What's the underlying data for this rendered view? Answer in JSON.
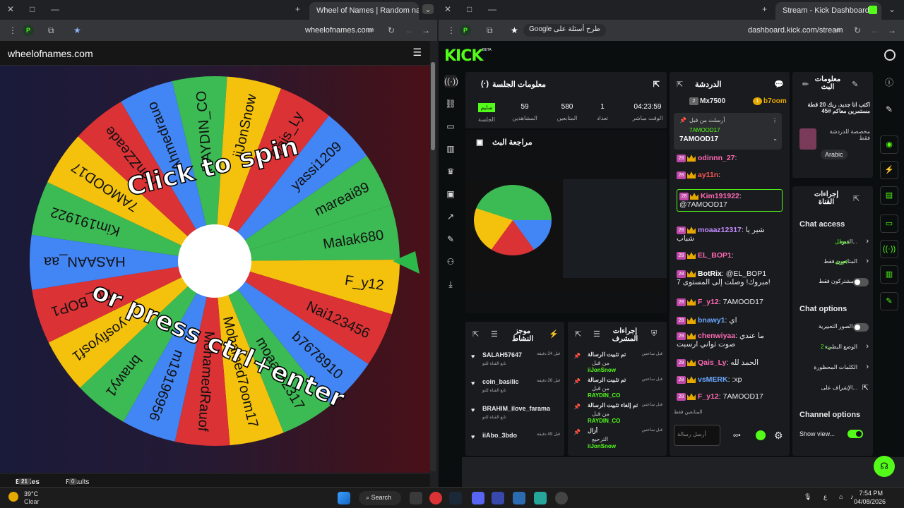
{
  "left_browser": {
    "tab_title": "Wheel of Names | Random nam",
    "url": "wheelofnames.com",
    "site_title": "wheelofnames.com",
    "wheel": {
      "names": [
        "Malak680",
        "F_y12",
        "Nai123456",
        "b7678910",
        "moaaz12317",
        "Mohamed7oom17",
        "MohamedRauof",
        "m19196956",
        "bnawy1",
        "yosfiyosf1",
        "EL_BOP1",
        "HASAAN_aa",
        "Kim191922",
        "7AMOOD17",
        "KenZZeade",
        "Ahmedrauo",
        "RAYDIN_CO",
        "iiJonSnow",
        "Qais_Ly",
        "yassi1209",
        "mareai89"
      ],
      "colors": [
        "#3cba54",
        "#4285f4",
        "#db3236",
        "#f4c20d"
      ],
      "center_text_top": "Click to spin",
      "center_text_bottom": "or press ctrl+enter"
    },
    "tabs": {
      "entries": "Entries",
      "entries_count": "21",
      "results": "Results",
      "results_count": "0"
    }
  },
  "right_browser": {
    "tab_title": "Stream - Kick Dashboard",
    "url": "dashboard.kick.com/stream",
    "ask_google": "Google طرح أسئلة على",
    "kick_logo": "KICK",
    "session": {
      "title": "معلومات الجلسة",
      "stats": [
        {
          "value": "04:23:59",
          "label": "الوقت مباشر"
        },
        {
          "value": "1",
          "label": "تعداد"
        },
        {
          "value": "580",
          "label": "المتابعين"
        },
        {
          "value": "59",
          "label": "المشاهدين"
        },
        {
          "value": "سليم",
          "label": "الجلسة"
        }
      ]
    },
    "review": {
      "title": "مراجعة البث"
    },
    "activity": {
      "title": "موجز النشاط",
      "items": [
        {
          "name": "SALAH57647",
          "sub": "تابع القناة للتو",
          "time": "قبل 24 دقيقة"
        },
        {
          "name": "coin_basilic",
          "sub": "تابع القناة للتو",
          "time": "قبل 26 دقيقة"
        },
        {
          "name": "BRAHIM_ilove_farama",
          "sub": "تابع القناة للتو",
          "time": ""
        },
        {
          "name": "iiAbo_3bdo",
          "sub": "",
          "time": "قبل 49 دقيقة"
        }
      ]
    },
    "mod_actions": {
      "title": "إجراءات المشرف",
      "items": [
        {
          "action": "تم تثبيت الرسالة",
          "by": "من قبل",
          "user": "iiJonSnow",
          "time": "قبل ساعتين"
        },
        {
          "action": "تم تثبيت الرسالة",
          "by": "من قبل",
          "user": "RAYDIN_CO",
          "time": "قبل ساعتين"
        },
        {
          "action": "تم إلغاء تثبيت الرسالة",
          "by": "من قبل",
          "user": "RAYDIN_CO",
          "time": "قبل ساعتين"
        },
        {
          "action": "أزال",
          "by": "الترحيع",
          "user": "iiJonSnow",
          "time": "قبل ساعتين"
        }
      ]
    },
    "chat": {
      "title": "الدردشة",
      "top_users": [
        {
          "name": "Mx7500",
          "rank": "2"
        },
        {
          "name": "b7oom",
          "rank": "1"
        }
      ],
      "pinned": {
        "label": "أرسلت من قبل",
        "user": "7AMOOD17",
        "text": "7AMOOD17"
      },
      "messages": [
        {
          "user": "odinnn_27",
          "text": "",
          "color": "#ff69b4"
        },
        {
          "user": "ay11n",
          "text": "",
          "color": "#ff5555"
        },
        {
          "user": "Kim191922",
          "text": "@7AMOOD17",
          "color": "#ff69b4"
        },
        {
          "user": "moaaz12317",
          "text": "شير يا شباب",
          "color": "#c48cff"
        },
        {
          "user": "EL_BOP1",
          "text": "",
          "color": "#ff69b4"
        },
        {
          "user": "BotRix",
          "text": "@EL_BOP1 مبروك! وصلت إلى المستوى 7!",
          "color": "#fff"
        },
        {
          "user": "F_y12",
          "text": "7AMOOD17",
          "color": "#ff69b4"
        },
        {
          "user": "bnawy1",
          "text": "اي",
          "color": "#6aa8ff"
        },
        {
          "user": "chenwiyaa",
          "text": "ما عندي صوت ثواني ارسبت",
          "color": "#ff69b4"
        },
        {
          "user": "Qais_Ly",
          "text": "الحمد لله",
          "color": "#ff69b4"
        },
        {
          "user": "vsMERK",
          "text": ":xp",
          "color": "#6aa8ff"
        },
        {
          "user": "F_y12",
          "text": "7AMOOD17",
          "color": "#ff69b4"
        }
      ],
      "followers_only": "المتابعين فقط",
      "send_placeholder": "أرسل رسالة"
    },
    "stream_info": {
      "title": "معلومات البث",
      "desc": "اكتب انا جديد. ربك 20 قطة مستمرين معاكم #45",
      "tag": "مخصصة للدردشة فقط",
      "language": "Arabic"
    },
    "channel_actions": {
      "title": "إجراءات القناة",
      "chat_access": "Chat access",
      "access_rows": [
        {
          "label": "القيود...",
          "value": "معطل"
        },
        {
          "label": "المتابعون فقط",
          "value": "فوري"
        },
        {
          "label": "المشتركون فقط",
          "value": ""
        }
      ],
      "chat_options": "Chat options",
      "option_rows": [
        {
          "label": "الصور التعبيرية...",
          "value": ""
        },
        {
          "label": "الوضع البطيء",
          "value": "2 ث"
        },
        {
          "label": "الكلمات المحظورة",
          "value": ""
        },
        {
          "label": "الإشراف على...",
          "value": ""
        }
      ],
      "channel_options": "Channel options",
      "show_viewers": "Show view..."
    }
  },
  "taskbar": {
    "weather_temp": "39°C",
    "weather_desc": "Clear",
    "search": "Search",
    "time": "7:54 PM",
    "date": "04/08/2026",
    "lang": "ع"
  }
}
